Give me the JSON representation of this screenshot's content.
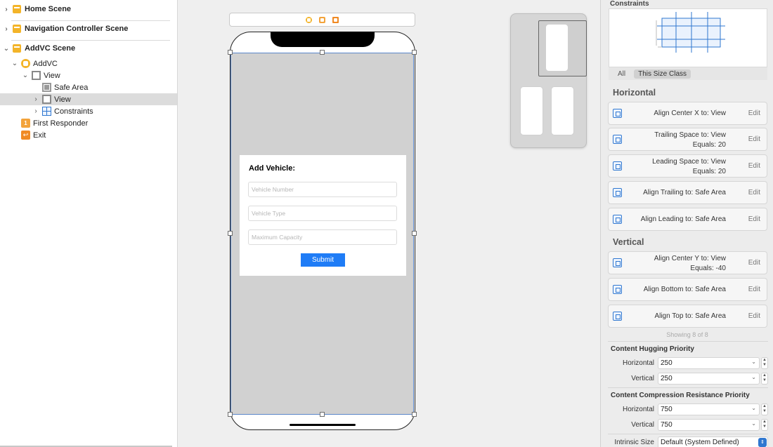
{
  "outline": {
    "scenes": [
      {
        "label": "Home Scene",
        "expanded": false
      },
      {
        "label": "Navigation Controller Scene",
        "expanded": false
      },
      {
        "label": "AddVC Scene",
        "expanded": true
      }
    ],
    "tree": [
      {
        "label": "AddVC",
        "icon": "view-controller-icon",
        "disclosure": "open"
      },
      {
        "label": "View",
        "icon": "view-icon",
        "disclosure": "open"
      },
      {
        "label": "Safe Area",
        "icon": "safe-area-icon",
        "disclosure": "none"
      },
      {
        "label": "View",
        "icon": "view-icon",
        "disclosure": "closed",
        "selected": true
      },
      {
        "label": "Constraints",
        "icon": "constraints-icon",
        "disclosure": "closed"
      },
      {
        "label": "First Responder",
        "icon": "first-responder-icon",
        "disclosure": "none"
      },
      {
        "label": "Exit",
        "icon": "exit-icon",
        "disclosure": "none"
      }
    ]
  },
  "canvas": {
    "scene_bar_icons": [
      "view-controller-icon",
      "first-responder-icon",
      "exit-icon"
    ],
    "card": {
      "title": "Add Vehicle:",
      "fields": [
        {
          "placeholder": "Vehicle Number"
        },
        {
          "placeholder": "Vehicle Type"
        },
        {
          "placeholder": "Maximum Capacity"
        }
      ],
      "submit_label": "Submit"
    },
    "colors": {
      "view_bg": "#d1d1d1",
      "submit_bg": "#1f7cf6",
      "selection": "#5b86c9"
    }
  },
  "inspector": {
    "constraints_title": "Constraints",
    "size_tabs": {
      "all": "All",
      "this_size_class": "This Size Class"
    },
    "horizontal_title": "Horizontal",
    "horizontal": [
      {
        "line1": "Align Center X to:  View",
        "line2": "",
        "edit": "Edit"
      },
      {
        "line1": "Trailing Space to:  View",
        "line2": "Equals:  20",
        "edit": "Edit"
      },
      {
        "line1": "Leading Space to:  View",
        "line2": "Equals:  20",
        "edit": "Edit"
      },
      {
        "line1": "Align Trailing to:  Safe Area",
        "line2": "",
        "edit": "Edit"
      },
      {
        "line1": "Align Leading to:  Safe Area",
        "line2": "",
        "edit": "Edit"
      }
    ],
    "vertical_title": "Vertical",
    "vertical": [
      {
        "line1": "Align Center Y to:  View",
        "line2": "Equals:  -40",
        "edit": "Edit"
      },
      {
        "line1": "Align Bottom to:  Safe Area",
        "line2": "",
        "edit": "Edit"
      },
      {
        "line1": "Align Top to:  Safe Area",
        "line2": "",
        "edit": "Edit"
      }
    ],
    "showing": "Showing 8 of 8",
    "hugging": {
      "title": "Content Hugging Priority",
      "horizontal_label": "Horizontal",
      "horizontal": "250",
      "vertical_label": "Vertical",
      "vertical": "250"
    },
    "compression": {
      "title": "Content Compression Resistance Priority",
      "horizontal_label": "Horizontal",
      "horizontal": "750",
      "vertical_label": "Vertical",
      "vertical": "750"
    },
    "intrinsic": {
      "label": "Intrinsic Size",
      "value": "Default (System Defined)"
    }
  }
}
